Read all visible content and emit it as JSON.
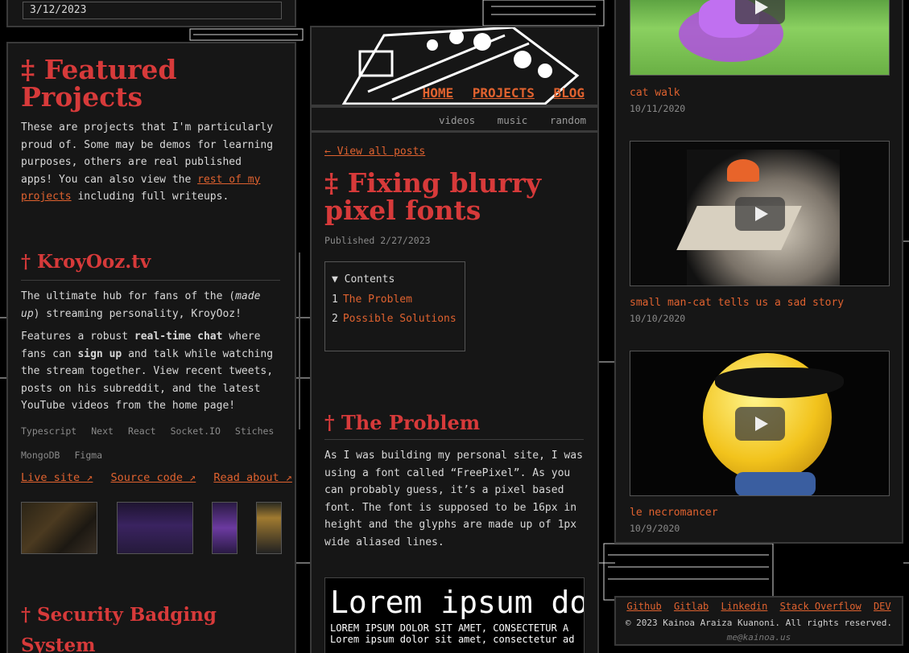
{
  "top_date": "3/12/2023",
  "featured": {
    "heading": "‡ Featured Projects",
    "intro_1": "These are projects that I'm particularly proud of. Some may be demos for learning purposes, others are real published apps! You can also view the ",
    "intro_link": "rest of my projects",
    "intro_2": " including full writeups.",
    "project1": {
      "title": "† KroyOoz.tv",
      "desc_a_1": "The ultimate hub for fans of the (",
      "desc_a_em": "made up",
      "desc_a_2": ") streaming personality, KroyOoz!",
      "desc_b_1": "Features a robust ",
      "desc_b_strong1": "real-time chat",
      "desc_b_2": " where fans can ",
      "desc_b_strong2": "sign up",
      "desc_b_3": " and talk while watching the stream together. View recent tweets, posts on his subreddit, and the latest YouTube videos from the home page!",
      "tags": [
        "Typescript",
        "Next",
        "React",
        "Socket.IO",
        "Stiches",
        "MongoDB",
        "Figma"
      ],
      "links": [
        "Live site ↗",
        "Source code ↗",
        "Read about ↗"
      ]
    },
    "project2": {
      "title": "† Security Badging System"
    }
  },
  "nav": {
    "main": [
      "HOME",
      "PROJECTS",
      "BLOG"
    ],
    "sub": [
      "videos",
      "music",
      "random"
    ]
  },
  "post": {
    "back": "← View all posts",
    "title": "‡ Fixing blurry pixel fonts",
    "published": "Published 2/27/2023",
    "toc_label": "▼ Contents",
    "toc": [
      {
        "num": "1",
        "label": "The Problem"
      },
      {
        "num": "2",
        "label": "Possible Solutions"
      }
    ],
    "section_title": "† The Problem",
    "body_1": "As I was building my personal site, I was using a font called “FreePixel”. As you can probably guess, it’s a pixel based font. The font is supposed to be 16px in height and the glyphs are made up of 1px wide aliased lines.",
    "sample_big": "Lorem ipsum do",
    "sample_caps": "LOREM IPSUM DOLOR SIT AMET, CONSECTETUR A",
    "sample_small": "Lorem ipsum dolor sit amet, consectetur ad"
  },
  "videos": [
    {
      "title": "cat walk",
      "date": "10/11/2020"
    },
    {
      "title": "small man-cat tells us a sad story",
      "date": "10/10/2020"
    },
    {
      "title": "le necromancer",
      "date": "10/9/2020"
    }
  ],
  "footer": {
    "links": [
      "Github",
      "Gitlab",
      "Linkedin",
      "Stack Overflow",
      "DEV"
    ],
    "copyright": "© 2023 Kainoa Araiza Kuanoni. All rights reserved.",
    "email": "me@kainoa.us"
  },
  "colors": {
    "accent": "#e0622f",
    "title_red": "#d73a3a",
    "panel": "#161616",
    "border": "#3a3a3a"
  }
}
